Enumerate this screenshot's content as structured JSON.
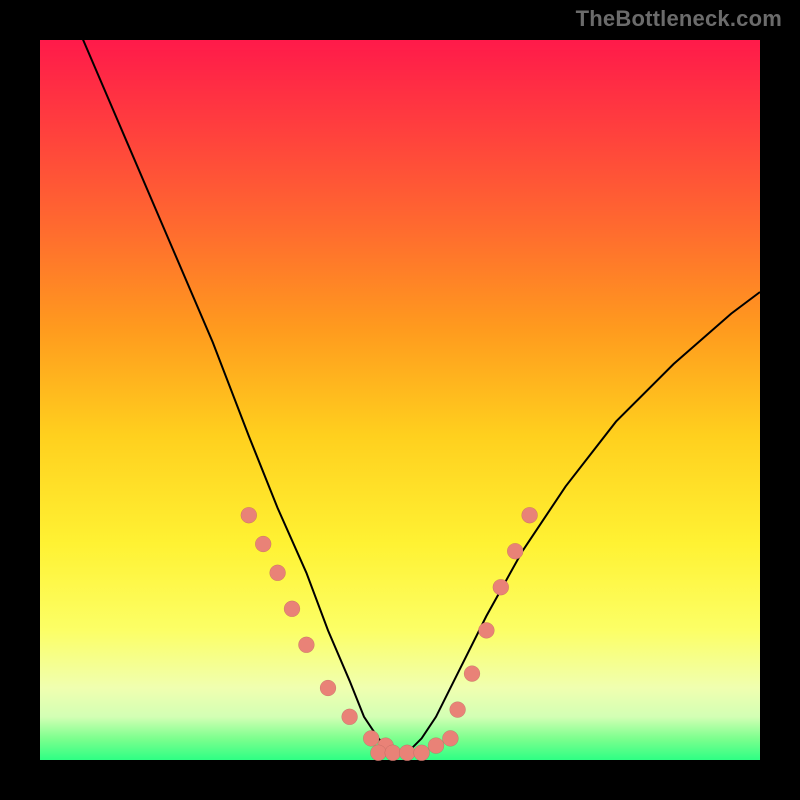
{
  "watermark": "TheBottleneck.com",
  "colors": {
    "page_bg": "#000000",
    "curve": "#000000",
    "dot": "#e98277",
    "gradient_top": "#ff1a4a",
    "gradient_bottom": "#2eff84"
  },
  "chart_data": {
    "type": "line",
    "title": "",
    "xlabel": "",
    "ylabel": "",
    "xlim": [
      0,
      100
    ],
    "ylim": [
      0,
      100
    ],
    "legend": false,
    "grid": false,
    "series": [
      {
        "name": "bottleneck-percent",
        "x": [
          0,
          6,
          12,
          18,
          24,
          29,
          33,
          37,
          40,
          43,
          45,
          47,
          49,
          51,
          53,
          55,
          58,
          62,
          67,
          73,
          80,
          88,
          96,
          100
        ],
        "y": [
          112,
          100,
          86,
          72,
          58,
          45,
          35,
          26,
          18,
          11,
          6,
          3,
          1,
          1,
          3,
          6,
          12,
          20,
          29,
          38,
          47,
          55,
          62,
          65
        ]
      },
      {
        "name": "markers-left",
        "x": [
          29,
          31,
          33,
          35,
          37,
          40,
          43,
          46,
          48
        ],
        "y": [
          34,
          30,
          26,
          21,
          16,
          10,
          6,
          3,
          2
        ]
      },
      {
        "name": "markers-bottom",
        "x": [
          47,
          49,
          51,
          53,
          55,
          57
        ],
        "y": [
          1,
          1,
          1,
          1,
          2,
          3
        ]
      },
      {
        "name": "markers-right",
        "x": [
          58,
          60,
          62,
          64,
          66,
          68
        ],
        "y": [
          7,
          12,
          18,
          24,
          29,
          34
        ]
      }
    ],
    "annotations": []
  }
}
